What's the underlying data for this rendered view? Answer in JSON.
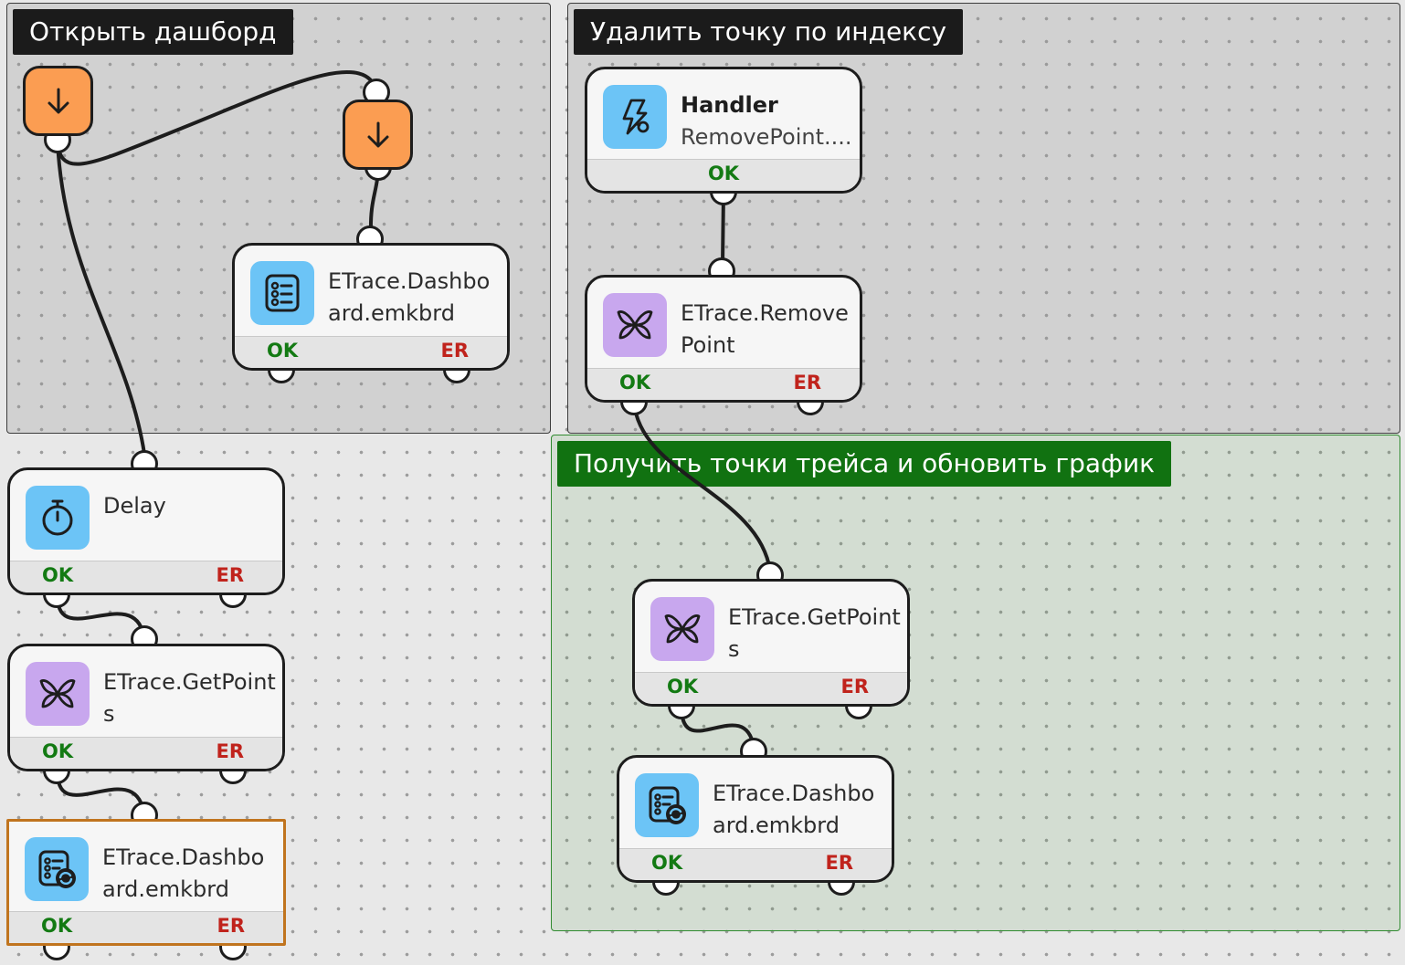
{
  "groups": {
    "open_dashboard": {
      "title": "Открыть дашборд"
    },
    "delete_point": {
      "title": "Удалить точку по индексу"
    },
    "get_points": {
      "title": "Получить точки трейса и обновить график"
    }
  },
  "nodes": {
    "dashboard_open": {
      "line1": "ETrace.Dashbo",
      "line2": "ard.emkbrd",
      "icon": "dashboard-list-icon",
      "ok": "OK",
      "er": "ER"
    },
    "handler": {
      "line1": "Handler",
      "line2": "RemovePoint....",
      "icon": "handler-event-icon",
      "ok": "OK"
    },
    "remove_point": {
      "line1": "ETrace.Remove",
      "line2": "Point",
      "icon": "butterfly-icon",
      "ok": "OK",
      "er": "ER"
    },
    "delay": {
      "line1": "Delay",
      "line2": "",
      "icon": "stopwatch-icon",
      "ok": "OK",
      "er": "ER"
    },
    "get_points_left": {
      "line1": "ETrace.GetPoint",
      "line2": "s",
      "icon": "butterfly-icon",
      "ok": "OK",
      "er": "ER"
    },
    "dashboard_refresh_left": {
      "line1": "ETrace.Dashbo",
      "line2": "ard.emkbrd",
      "icon": "dashboard-refresh-icon",
      "ok": "OK",
      "er": "ER",
      "selected": true
    },
    "get_points_right": {
      "line1": "ETrace.GetPoint",
      "line2": "s",
      "icon": "butterfly-icon",
      "ok": "OK",
      "er": "ER"
    },
    "dashboard_refresh_right": {
      "line1": "ETrace.Dashbo",
      "line2": "ard.emkbrd",
      "icon": "dashboard-refresh-icon",
      "ok": "OK",
      "er": "ER"
    }
  },
  "entry_nodes": [
    {
      "icon": "arrow-down-icon"
    },
    {
      "icon": "arrow-down-icon"
    }
  ],
  "colors": {
    "canvas": "#e8e8e8",
    "group_header": "#1b1b1b",
    "group_header_green": "#117211",
    "ok": "#137a13",
    "er": "#c0231c",
    "entry_node": "#fb9d52",
    "icon_blue": "#6cc4f6",
    "icon_purple": "#c8a7ee",
    "selection": "#c0741e"
  }
}
